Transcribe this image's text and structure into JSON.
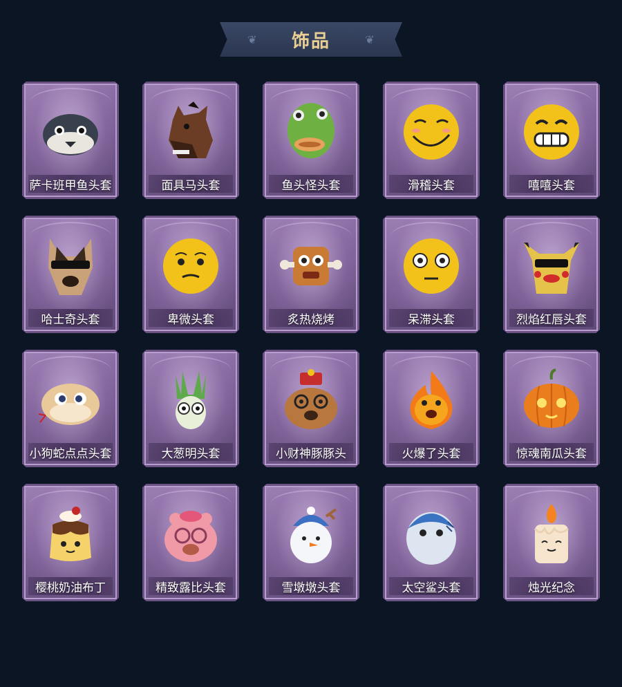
{
  "header": {
    "title": "饰品"
  },
  "items": [
    {
      "label": "萨卡班甲鱼头套",
      "icon": "fish-mask-icon"
    },
    {
      "label": "面具马头套",
      "icon": "horse-mask-icon"
    },
    {
      "label": "鱼头怪头套",
      "icon": "fish-head-icon"
    },
    {
      "label": "滑稽头套",
      "icon": "smirk-face-icon"
    },
    {
      "label": "嘻嘻头套",
      "icon": "grin-face-icon"
    },
    {
      "label": "哈士奇头套",
      "icon": "husky-icon"
    },
    {
      "label": "卑微头套",
      "icon": "humble-face-icon"
    },
    {
      "label": "炙热烧烤",
      "icon": "bbq-meat-icon"
    },
    {
      "label": "呆滞头套",
      "icon": "dazed-face-icon"
    },
    {
      "label": "烈焰红唇头套",
      "icon": "red-lips-icon"
    },
    {
      "label": "小狗蛇点点头套",
      "icon": "snake-icon"
    },
    {
      "label": "大葱明头套",
      "icon": "scallion-icon"
    },
    {
      "label": "小财神豚豚头",
      "icon": "capybara-icon"
    },
    {
      "label": "火爆了头套",
      "icon": "fire-icon"
    },
    {
      "label": "惊魂南瓜头套",
      "icon": "pumpkin-icon"
    },
    {
      "label": "樱桃奶油布丁",
      "icon": "pudding-icon"
    },
    {
      "label": "精致露比头套",
      "icon": "beaver-icon"
    },
    {
      "label": "雪墩墩头套",
      "icon": "snowman-icon"
    },
    {
      "label": "太空鲨头套",
      "icon": "shark-icon"
    },
    {
      "label": "烛光纪念",
      "icon": "candle-icon"
    }
  ]
}
